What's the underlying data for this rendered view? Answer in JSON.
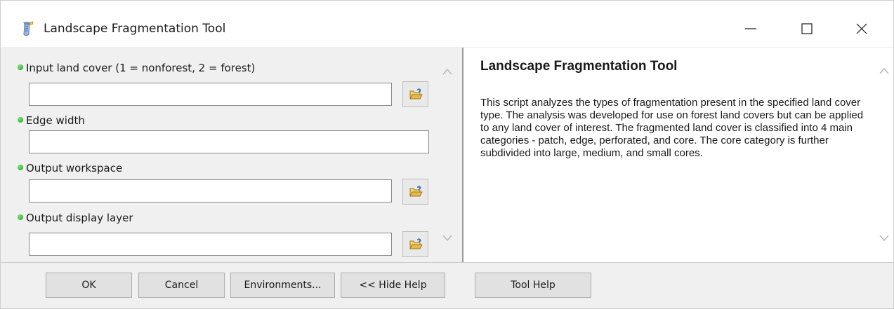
{
  "window": {
    "title": "Landscape Fragmentation Tool"
  },
  "parameters": [
    {
      "label": "Input land cover (1 = nonforest, 2 = forest)",
      "value": "",
      "has_browse": true
    },
    {
      "label": "Edge width",
      "value": "",
      "has_browse": false
    },
    {
      "label": "Output workspace",
      "value": "",
      "has_browse": true
    },
    {
      "label": "Output display layer",
      "value": "",
      "has_browse": true
    }
  ],
  "help": {
    "title": "Landscape Fragmentation Tool",
    "body": "This script analyzes the types of fragmentation present in the specified land cover type. The analysis was developed for use on forest land covers but can be applied to any land cover of interest. The fragmented land cover is classified into 4 main categories - patch, edge, perforated, and core. The core category is further subdivided into large, medium, and small cores."
  },
  "buttons": {
    "ok": "OK",
    "cancel": "Cancel",
    "environments": "Environments...",
    "hide_help": "<< Hide Help",
    "tool_help": "Tool Help"
  },
  "icons": {
    "app": "script-tool-icon",
    "browse": "open-folder-icon",
    "required": "green-dot-icon"
  },
  "colors": {
    "required_dot": "#2faa2f",
    "folder": "#e8b84a"
  }
}
